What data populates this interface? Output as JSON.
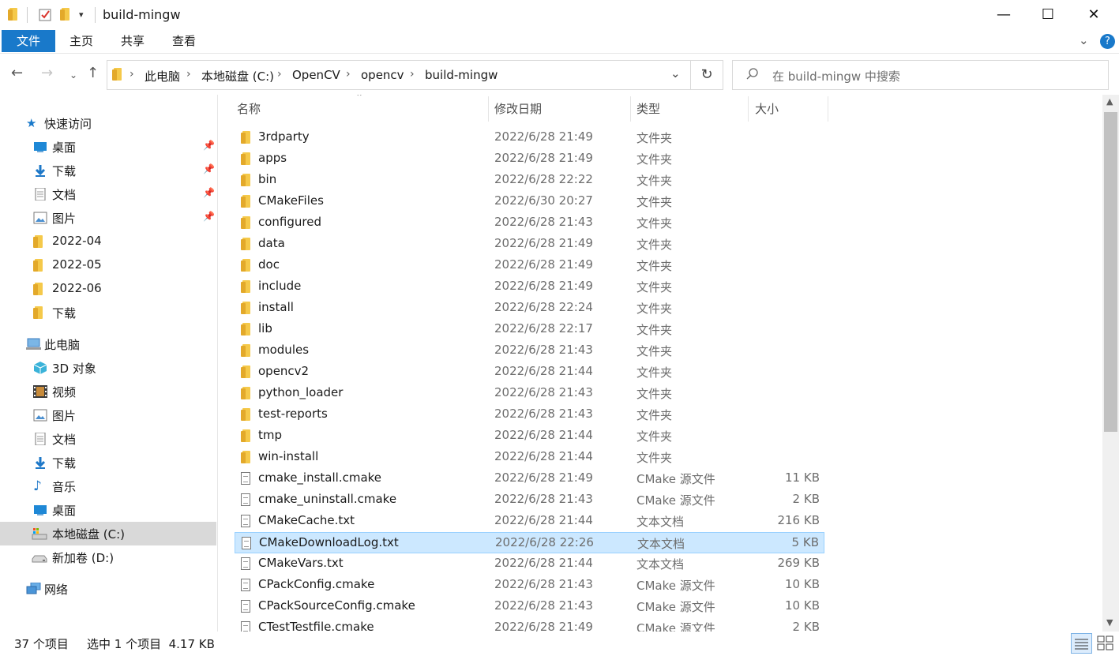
{
  "window": {
    "title": "build-mingw",
    "minimize": "—",
    "maximize": "☐",
    "close": "✕"
  },
  "ribbon": {
    "tabs": [
      "文件",
      "主页",
      "共享",
      "查看"
    ]
  },
  "nav": {
    "breadcrumbs": [
      "此电脑",
      "本地磁盘 (C:)",
      "OpenCV",
      "opencv",
      "build-mingw"
    ],
    "search_placeholder": "在 build-mingw 中搜索"
  },
  "sidebar": {
    "quick_access": "快速访问",
    "quick_items": [
      {
        "label": "桌面",
        "icon": "desktop-icon",
        "pinned": true
      },
      {
        "label": "下载",
        "icon": "download-icon",
        "pinned": true
      },
      {
        "label": "文档",
        "icon": "document-icon",
        "pinned": true
      },
      {
        "label": "图片",
        "icon": "picture-icon",
        "pinned": true
      },
      {
        "label": "2022-04",
        "icon": "folder-icon",
        "pinned": false
      },
      {
        "label": "2022-05",
        "icon": "folder-icon",
        "pinned": false
      },
      {
        "label": "2022-06",
        "icon": "folder-icon",
        "pinned": false
      },
      {
        "label": "下载",
        "icon": "folder-icon",
        "pinned": false
      }
    ],
    "this_pc": "此电脑",
    "pc_items": [
      {
        "label": "3D 对象",
        "icon": "3d-objects-icon"
      },
      {
        "label": "视频",
        "icon": "video-icon"
      },
      {
        "label": "图片",
        "icon": "picture-icon"
      },
      {
        "label": "文档",
        "icon": "document-icon"
      },
      {
        "label": "下载",
        "icon": "download-icon"
      },
      {
        "label": "音乐",
        "icon": "music-icon"
      },
      {
        "label": "桌面",
        "icon": "desktop-icon"
      },
      {
        "label": "本地磁盘 (C:)",
        "icon": "local-disk-icon",
        "selected": true
      },
      {
        "label": "新加卷 (D:)",
        "icon": "drive-icon"
      }
    ],
    "network": "网络"
  },
  "list": {
    "columns": {
      "name": "名称",
      "date": "修改日期",
      "type": "类型",
      "size": "大小"
    },
    "rows": [
      {
        "name": "3rdparty",
        "date": "2022/6/28 21:49",
        "type": "文件夹",
        "size": "",
        "kind": "folder"
      },
      {
        "name": "apps",
        "date": "2022/6/28 21:49",
        "type": "文件夹",
        "size": "",
        "kind": "folder"
      },
      {
        "name": "bin",
        "date": "2022/6/28 22:22",
        "type": "文件夹",
        "size": "",
        "kind": "folder"
      },
      {
        "name": "CMakeFiles",
        "date": "2022/6/30 20:27",
        "type": "文件夹",
        "size": "",
        "kind": "folder"
      },
      {
        "name": "configured",
        "date": "2022/6/28 21:43",
        "type": "文件夹",
        "size": "",
        "kind": "folder"
      },
      {
        "name": "data",
        "date": "2022/6/28 21:49",
        "type": "文件夹",
        "size": "",
        "kind": "folder"
      },
      {
        "name": "doc",
        "date": "2022/6/28 21:49",
        "type": "文件夹",
        "size": "",
        "kind": "folder"
      },
      {
        "name": "include",
        "date": "2022/6/28 21:49",
        "type": "文件夹",
        "size": "",
        "kind": "folder"
      },
      {
        "name": "install",
        "date": "2022/6/28 22:24",
        "type": "文件夹",
        "size": "",
        "kind": "folder"
      },
      {
        "name": "lib",
        "date": "2022/6/28 22:17",
        "type": "文件夹",
        "size": "",
        "kind": "folder"
      },
      {
        "name": "modules",
        "date": "2022/6/28 21:43",
        "type": "文件夹",
        "size": "",
        "kind": "folder"
      },
      {
        "name": "opencv2",
        "date": "2022/6/28 21:44",
        "type": "文件夹",
        "size": "",
        "kind": "folder"
      },
      {
        "name": "python_loader",
        "date": "2022/6/28 21:43",
        "type": "文件夹",
        "size": "",
        "kind": "folder"
      },
      {
        "name": "test-reports",
        "date": "2022/6/28 21:43",
        "type": "文件夹",
        "size": "",
        "kind": "folder"
      },
      {
        "name": "tmp",
        "date": "2022/6/28 21:44",
        "type": "文件夹",
        "size": "",
        "kind": "folder"
      },
      {
        "name": "win-install",
        "date": "2022/6/28 21:44",
        "type": "文件夹",
        "size": "",
        "kind": "folder"
      },
      {
        "name": "cmake_install.cmake",
        "date": "2022/6/28 21:49",
        "type": "CMake 源文件",
        "size": "11 KB",
        "kind": "file"
      },
      {
        "name": "cmake_uninstall.cmake",
        "date": "2022/6/28 21:43",
        "type": "CMake 源文件",
        "size": "2 KB",
        "kind": "file"
      },
      {
        "name": "CMakeCache.txt",
        "date": "2022/6/28 21:44",
        "type": "文本文档",
        "size": "216 KB",
        "kind": "file"
      },
      {
        "name": "CMakeDownloadLog.txt",
        "date": "2022/6/28 22:26",
        "type": "文本文档",
        "size": "5 KB",
        "kind": "file",
        "selected": true
      },
      {
        "name": "CMakeVars.txt",
        "date": "2022/6/28 21:44",
        "type": "文本文档",
        "size": "269 KB",
        "kind": "file"
      },
      {
        "name": "CPackConfig.cmake",
        "date": "2022/6/28 21:43",
        "type": "CMake 源文件",
        "size": "10 KB",
        "kind": "file"
      },
      {
        "name": "CPackSourceConfig.cmake",
        "date": "2022/6/28 21:43",
        "type": "CMake 源文件",
        "size": "10 KB",
        "kind": "file"
      },
      {
        "name": "CTestTestfile.cmake",
        "date": "2022/6/28 21:49",
        "type": "CMake 源文件",
        "size": "2 KB",
        "kind": "file"
      }
    ]
  },
  "status": {
    "count": "37 个项目",
    "selection": "选中 1 个项目  4.17 KB"
  }
}
